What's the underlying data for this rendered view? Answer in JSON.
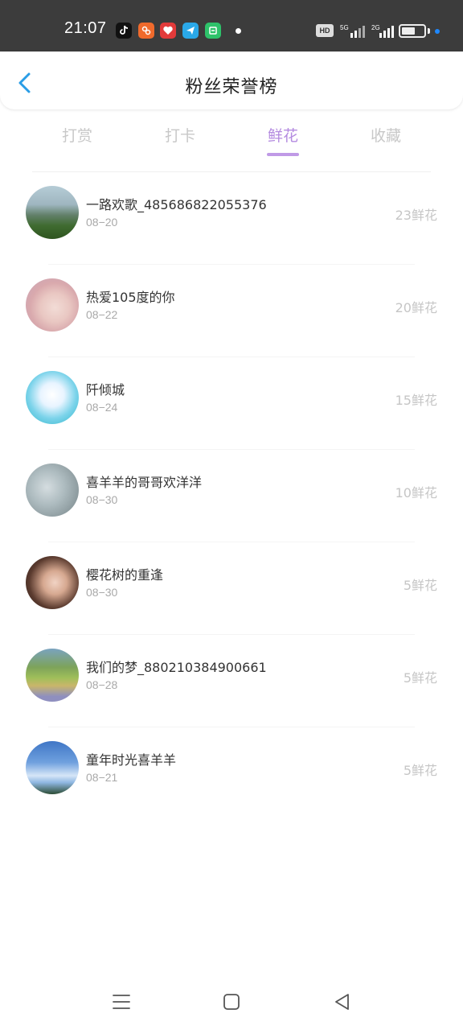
{
  "status_bar": {
    "time": "21:07",
    "hd_label": "HD",
    "network_1": "5G",
    "network_2": "2G",
    "battery_level": 0.6,
    "app_icons": [
      "tiktok-icon",
      "app-orange-icon",
      "app-red-icon",
      "app-blue-icon",
      "app-green-icon"
    ]
  },
  "header": {
    "title": "粉丝荣誉榜",
    "back_icon": "chevron-left-icon"
  },
  "tabs": [
    {
      "label": "打赏"
    },
    {
      "label": "打卡"
    },
    {
      "label": "鲜花",
      "active": true
    },
    {
      "label": "收藏"
    }
  ],
  "fans": [
    {
      "name": "一路欢歌_485686822055376",
      "date": "08−20",
      "count": "23鲜花"
    },
    {
      "name": "热爱105度的你",
      "date": "08−22",
      "count": "20鲜花"
    },
    {
      "name": "阡倾城",
      "date": "08−24",
      "count": "15鲜花"
    },
    {
      "name": "喜羊羊的哥哥欢洋洋",
      "date": "08−30",
      "count": "10鲜花"
    },
    {
      "name": "樱花树的重逢",
      "date": "08−30",
      "count": "5鲜花"
    },
    {
      "name": "我们的梦_880210384900661",
      "date": "08−28",
      "count": "5鲜花"
    },
    {
      "name": "童年时光喜羊羊",
      "date": "08−21",
      "count": "5鲜花"
    }
  ],
  "colors": {
    "accent": "#b48be0",
    "status_bar_bg": "#3c3c3c",
    "back_icon": "#2a9de6"
  },
  "bottom_nav": [
    "menu-icon",
    "home-square-icon",
    "back-triangle-icon"
  ]
}
